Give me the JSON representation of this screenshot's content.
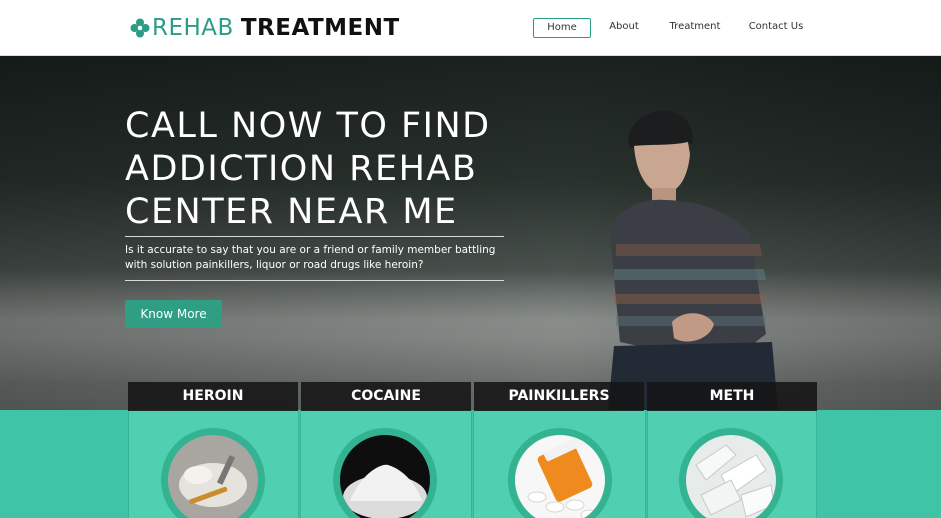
{
  "header": {
    "logo_light": "REHAB",
    "logo_bold": "TREATMENT",
    "nav": [
      {
        "label": "Home",
        "active": true
      },
      {
        "label": "About",
        "active": false
      },
      {
        "label": "Treatment",
        "active": false
      },
      {
        "label": "Contact Us",
        "active": false
      }
    ]
  },
  "hero": {
    "title_lines": [
      "CALL NOW TO FIND",
      "ADDICTION REHAB",
      "CENTER NEAR ME"
    ],
    "subtitle": "Is it accurate to say that you are or a friend or family member battling with solution painkillers, liquor or road drugs like heroin?",
    "button_label": "Know More"
  },
  "categories": [
    {
      "label": "HEROIN",
      "image": "heroin-image"
    },
    {
      "label": "COCAINE",
      "image": "cocaine-image"
    },
    {
      "label": "PAINKILLERS",
      "image": "painkillers-image"
    },
    {
      "label": "METH",
      "image": "meth-image"
    }
  ],
  "colors": {
    "accent": "#2a9d86",
    "button": "#2f9e82",
    "band": "#3fc4a5",
    "tab_bg": "#141414"
  }
}
